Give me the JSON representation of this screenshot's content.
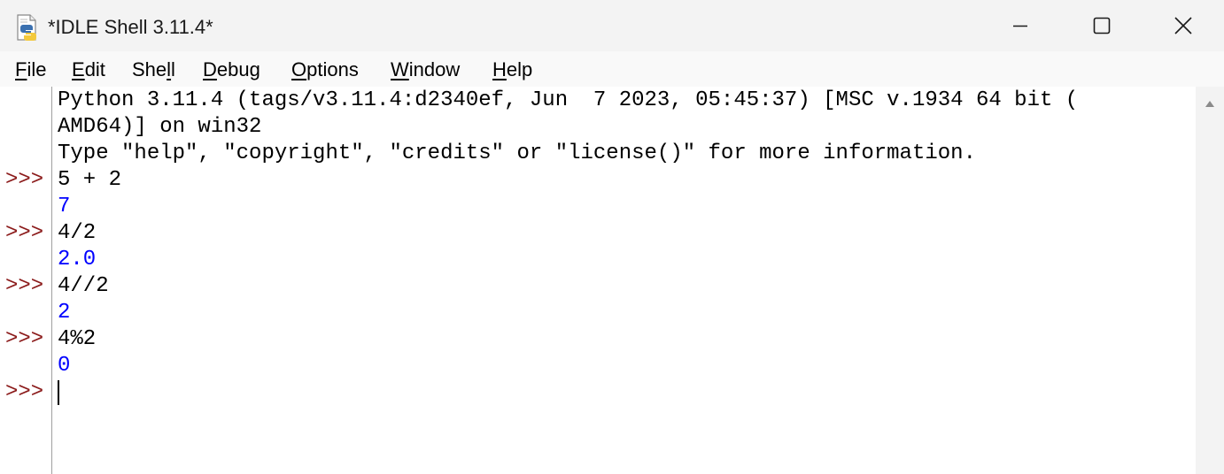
{
  "window": {
    "title": "*IDLE Shell 3.11.4*",
    "controls": {
      "minimize_icon": "minimize-icon",
      "maximize_icon": "maximize-icon",
      "close_icon": "close-icon"
    }
  },
  "menu": {
    "items": [
      {
        "mnemonic": "F",
        "rest": "ile"
      },
      {
        "mnemonic": "E",
        "rest": "dit"
      },
      {
        "pre": "She",
        "mnemonic": "l",
        "rest": "l"
      },
      {
        "mnemonic": "D",
        "rest": "ebug"
      },
      {
        "mnemonic": "O",
        "rest": "ptions"
      },
      {
        "mnemonic": "W",
        "rest": "indow"
      },
      {
        "mnemonic": "H",
        "rest": "elp"
      }
    ]
  },
  "shell": {
    "prompt": ">>>",
    "banner": [
      "Python 3.11.4 (tags/v3.11.4:d2340ef, Jun  7 2023, 05:45:37) [MSC v.1934 64 bit (",
      "AMD64)] on win32",
      "Type \"help\", \"copyright\", \"credits\" or \"license()\" for more information."
    ],
    "session": [
      {
        "input": "5 + 2",
        "output": "7"
      },
      {
        "input": "4/2",
        "output": "2.0"
      },
      {
        "input": "4//2",
        "output": "2"
      },
      {
        "input": "4%2",
        "output": "0"
      }
    ]
  },
  "colors": {
    "prompt": "#8b1a1a",
    "output": "#0000ff",
    "input": "#000000"
  }
}
